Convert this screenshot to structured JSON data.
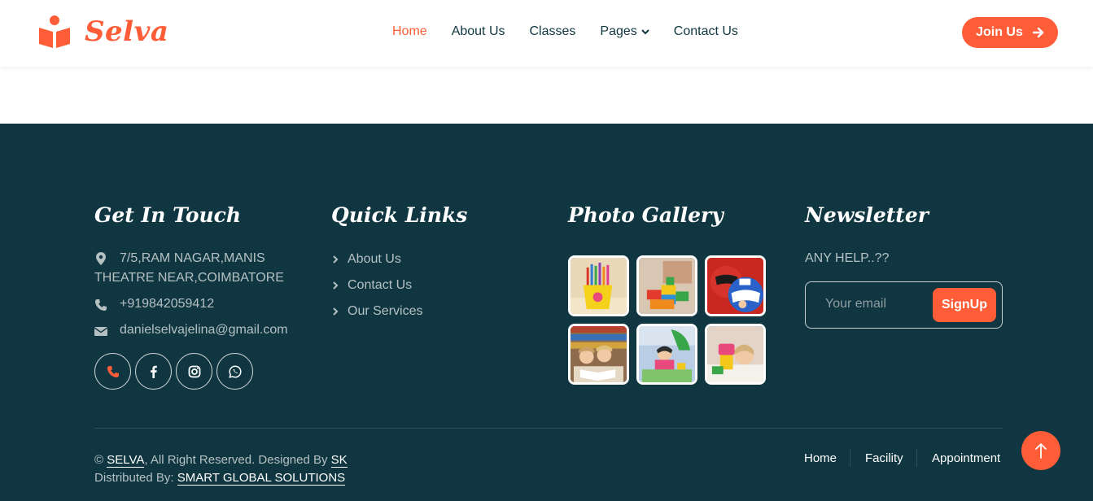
{
  "colors": {
    "accent": "#fe5d37",
    "dark": "#103741",
    "muted_text": "#b5c0c3",
    "white": "#ffffff"
  },
  "brand": {
    "name": "Selva",
    "icon": "reading-child-logo"
  },
  "nav": {
    "home": "Home",
    "about": "About Us",
    "classes": "Classes",
    "pages": "Pages",
    "contact": "Contact Us",
    "join": "Join Us"
  },
  "footer": {
    "get_in_touch": {
      "title": "Get In Touch",
      "address_line1": "7/5,RAM NAGAR,MANIS",
      "address_line2": "THEATRE NEAR,COIMBATORE",
      "phone": "+919842059412",
      "email": "danielselvajelina@gmail.com",
      "socials": [
        "phone-icon",
        "facebook-icon",
        "instagram-icon",
        "whatsapp-icon"
      ]
    },
    "quick_links": {
      "title": "Quick Links",
      "items": [
        "About Us",
        "Contact Us",
        "Our Services"
      ]
    },
    "photo_gallery": {
      "title": "Photo Gallery",
      "images": [
        "pencils-cup",
        "building-blocks",
        "superhero-masks",
        "kids-reading",
        "kids-playing",
        "child-crafts"
      ]
    },
    "newsletter": {
      "title": "Newsletter",
      "help_text": "ANY HELP..??",
      "email_placeholder": "Your email",
      "signup_label": "SignUp"
    },
    "copyright": {
      "symbol": "©",
      "brand": "SELVA",
      "text": ", All Right Reserved. Designed By",
      "designer": "SK",
      "distributed_label": "Distributed By:",
      "distributor": "SMART GLOBAL SOLUTIONS"
    },
    "bottom_nav": [
      "Home",
      "Facility",
      "Appointment"
    ]
  }
}
